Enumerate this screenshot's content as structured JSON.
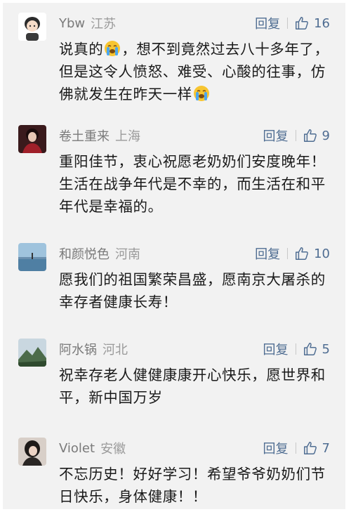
{
  "comments": [
    {
      "username": "Ybw",
      "location": "江苏",
      "reply_label": "回复",
      "likes": "16",
      "text_parts": [
        "说真的",
        "，想不到竟然过去八十多年了，但是这令人愤怒、难受、心酸的往事，仿佛就发生在昨天一样",
        ""
      ],
      "emoji": "crying-face-emoji"
    },
    {
      "username": "卷土重来",
      "location": "上海",
      "reply_label": "回复",
      "likes": "9",
      "text": "重阳佳节，衷心祝愿老奶奶们安度晚年！生活在战争年代是不幸的，而生活在和平年代是幸福的。"
    },
    {
      "username": "和颜悦色",
      "location": "河南",
      "reply_label": "回复",
      "likes": "10",
      "text": "愿我们的祖国繁荣昌盛，愿南京大屠杀的幸存者健康长寿！"
    },
    {
      "username": "阿水锅",
      "location": "河北",
      "reply_label": "回复",
      "likes": "5",
      "text": "祝幸存老人健健康康开心快乐，愿世界和平，新中国万岁"
    },
    {
      "username": "Violet",
      "location": "安徽",
      "reply_label": "回复",
      "likes": "7",
      "text": "不忘历史！好好学习！希望爷爷奶奶们节日快乐，身体健康！！"
    }
  ],
  "colors": {
    "background": "#f2f2f2",
    "action": "#4f6d92",
    "meta": "#8a8a8a",
    "text": "#1a1a1a"
  }
}
